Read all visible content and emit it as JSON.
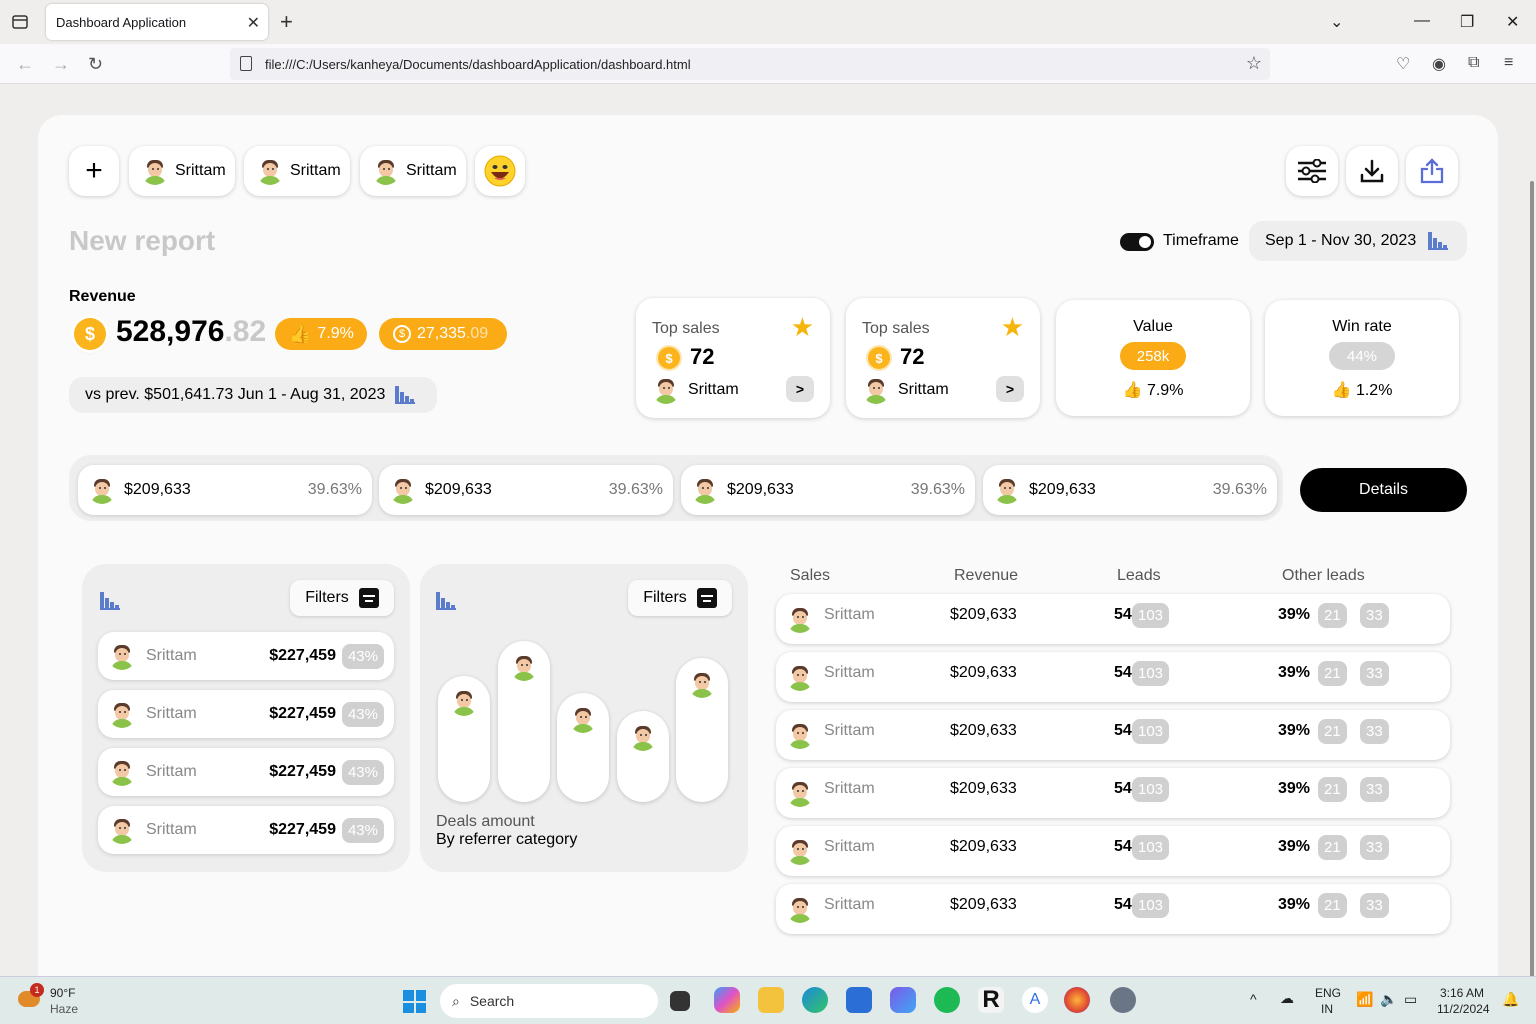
{
  "browser": {
    "tab_title": "Dashboard Application",
    "url": "file:///C:/Users/kanheya/Documents/dashboardApplication/dashboard.html"
  },
  "header": {
    "add_label": "+",
    "users": [
      "Srittam",
      "Srittam",
      "Srittam"
    ],
    "title": "New report",
    "timeframe_label": "Timeframe",
    "date_range": "Sep 1 - Nov 30, 2023"
  },
  "revenue": {
    "label": "Revenue",
    "coin_symbol": "$",
    "value_main": "528,976",
    "value_decimal": ".82",
    "growth": "7.9%",
    "extra_main": "27,335",
    "extra_decimal": ".09",
    "comparison": "vs prev. $501,641.73 Jun 1 - Aug 31, 2023"
  },
  "stats": {
    "top_sales": [
      {
        "title": "Top sales",
        "count": "72",
        "name": "Srittam"
      },
      {
        "title": "Top sales",
        "count": "72",
        "name": "Srittam"
      }
    ],
    "value": {
      "title": "Value",
      "badge": "258k",
      "change": "7.9%"
    },
    "win_rate": {
      "title": "Win rate",
      "badge": "44%",
      "change": "1.2%"
    }
  },
  "strip": [
    {
      "amount": "$209,633",
      "pct": "39.63%"
    },
    {
      "amount": "$209,633",
      "pct": "39.63%"
    },
    {
      "amount": "$209,633",
      "pct": "39.63%"
    },
    {
      "amount": "$209,633",
      "pct": "39.63%"
    }
  ],
  "details_label": "Details",
  "left_panel": {
    "filters_label": "Filters",
    "items": [
      {
        "name": "Srittam",
        "amount": "$227,459",
        "pct": "43%"
      },
      {
        "name": "Srittam",
        "amount": "$227,459",
        "pct": "43%"
      },
      {
        "name": "Srittam",
        "amount": "$227,459",
        "pct": "43%"
      },
      {
        "name": "Srittam",
        "amount": "$227,459",
        "pct": "43%"
      }
    ]
  },
  "deals_panel": {
    "filters_label": "Filters",
    "title": "Deals amount",
    "subtitle": "By referrer category"
  },
  "table": {
    "headers": [
      "Sales",
      "Revenue",
      "Leads",
      "Other leads"
    ],
    "rows": [
      {
        "name": "Srittam",
        "revenue": "$209,633",
        "leads": "54",
        "leads_badge": "103",
        "pct": "39%",
        "b1": "21",
        "b2": "33"
      },
      {
        "name": "Srittam",
        "revenue": "$209,633",
        "leads": "54",
        "leads_badge": "103",
        "pct": "39%",
        "b1": "21",
        "b2": "33"
      },
      {
        "name": "Srittam",
        "revenue": "$209,633",
        "leads": "54",
        "leads_badge": "103",
        "pct": "39%",
        "b1": "21",
        "b2": "33"
      },
      {
        "name": "Srittam",
        "revenue": "$209,633",
        "leads": "54",
        "leads_badge": "103",
        "pct": "39%",
        "b1": "21",
        "b2": "33"
      },
      {
        "name": "Srittam",
        "revenue": "$209,633",
        "leads": "54",
        "leads_badge": "103",
        "pct": "39%",
        "b1": "21",
        "b2": "33"
      },
      {
        "name": "Srittam",
        "revenue": "$209,633",
        "leads": "54",
        "leads_badge": "103",
        "pct": "39%",
        "b1": "21",
        "b2": "33"
      }
    ]
  },
  "taskbar": {
    "weather_temp": "90°F",
    "weather_desc": "Haze",
    "weather_badge": "1",
    "search_label": "Search",
    "lang": "ENG",
    "region": "IN",
    "time": "3:16 AM",
    "date": "11/2/2024"
  },
  "colors": {
    "accent_orange": "#fbab15",
    "coin": "#fbb41b",
    "chart_blue": "#5b7ccc"
  }
}
